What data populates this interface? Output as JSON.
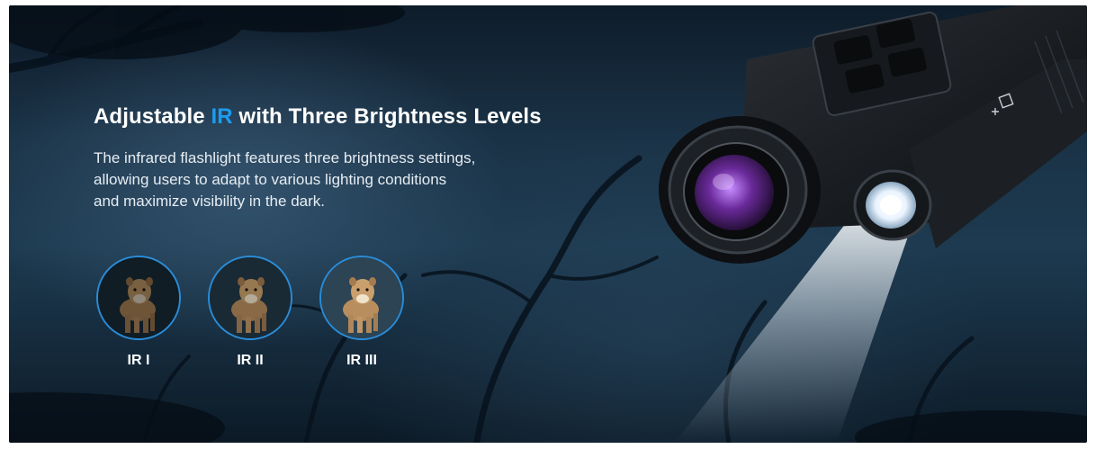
{
  "headline": {
    "prefix": "Adjustable ",
    "accent": "IR",
    "suffix": " with Three Brightness Levels"
  },
  "description": {
    "lines": [
      "The infrared flashlight features three brightness settings,",
      "allowing users to adapt to various lighting conditions",
      "and maximize visibility in the dark."
    ]
  },
  "levels": [
    {
      "label": "IR I",
      "brightness": 0.35
    },
    {
      "label": "IR II",
      "brightness": 0.6
    },
    {
      "label": "IR III",
      "brightness": 1.0
    }
  ],
  "colors": {
    "accent": "#1c9cf0",
    "ring": "#2a8cd8",
    "text": "#ffffff"
  },
  "icons": {
    "device_mode_mark": "plus-square-icon"
  }
}
